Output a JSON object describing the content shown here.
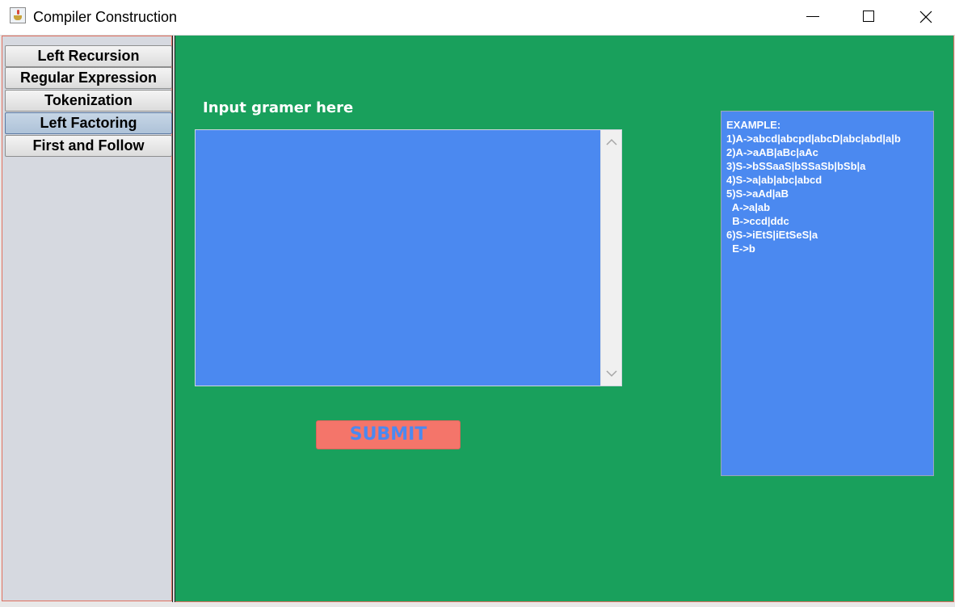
{
  "window": {
    "title": "Compiler Construction",
    "icon": "java-cup-icon"
  },
  "sidebar": {
    "tabs": [
      {
        "label": "Left Recursion",
        "active": false
      },
      {
        "label": "Regular Expression",
        "active": false
      },
      {
        "label": "Tokenization",
        "active": false
      },
      {
        "label": "Left Factoring",
        "active": true
      },
      {
        "label": "First and Follow",
        "active": false
      }
    ]
  },
  "main": {
    "input_label": "Input gramer here",
    "input_value": "",
    "submit_label": "SUBMIT",
    "example_lines": [
      "EXAMPLE:",
      "1)A->abcd|abcpd|abcD|abc|abd|a|b",
      "2)A->aAB|aBc|aAc",
      "3)S->bSSaaS|bSSaSb|bSb|a",
      "4)S->a|ab|abc|abcd",
      "5)S->aAd|aB",
      "  A->a|ab",
      "  B->ccd|ddc",
      "6)S->iEtS|iEtSeS|a",
      "  E->b"
    ]
  },
  "colors": {
    "main_bg": "#19a05c",
    "field_bg": "#4b89f0",
    "submit_bg": "#f4756a",
    "sidebar_bg": "#d6d9e0"
  }
}
